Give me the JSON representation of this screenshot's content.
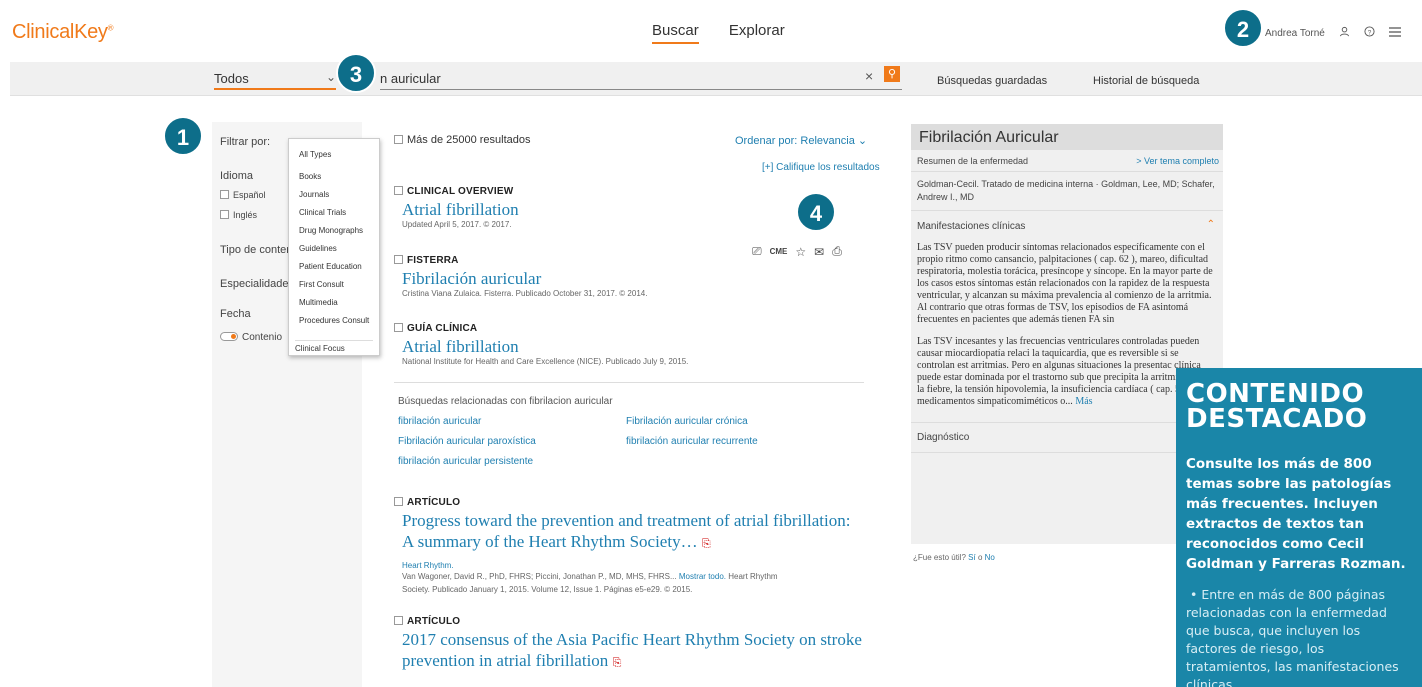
{
  "header": {
    "logo": "ClinicalKey",
    "logo_mark": "®",
    "nav": [
      "Buscar",
      "Explorar"
    ],
    "user_name": "Andrea Torné"
  },
  "search": {
    "scope": "Todos",
    "query": "n auricular",
    "saved": "Búsquedas guardadas",
    "history": "Historial de búsqueda"
  },
  "badges": [
    "1",
    "2",
    "3",
    "4"
  ],
  "filters": {
    "title": "Filtrar por:",
    "language_label": "Idioma",
    "languages": [
      "Español",
      "Inglés"
    ],
    "content_type": "Tipo de conter",
    "specialty": "Especialidade",
    "date": "Fecha",
    "content_toggle": "Contenio"
  },
  "dropdown": [
    "All Types",
    "Books",
    "Journals",
    "Clinical Trials",
    "Drug Monographs",
    "Guidelines",
    "Patient Education",
    "First Consult",
    "Multimedia",
    "Procedures Consult",
    "Clinical Focus"
  ],
  "results": {
    "count": "Más de 25000 resultados",
    "sort": "Ordenar por: Relevancia",
    "rate": "[+] Califique los resultados",
    "items": [
      {
        "label": "CLINICAL OVERVIEW",
        "title": "Atrial fibrillation",
        "meta": "Updated April 5, 2017. © 2017."
      },
      {
        "label": "FISTERRA",
        "title": "Fibrilación auricular",
        "meta": "Cristina Viana Zulaica. Fisterra. Publicado October 31, 2017. © 2014."
      },
      {
        "label": "GUÍA CLÍNICA",
        "title": "Atrial fibrillation",
        "meta": "National Institute for Health and Care Excellence (NICE). Publicado July 9, 2015."
      }
    ],
    "related_title": "Búsquedas relacionadas con fibrilacion auricular",
    "related": [
      "fibrilación auricular",
      "Fibrilación auricular crónica",
      "Fibrilación auricular paroxística",
      "fibrilación auricular recurrente",
      "fibrilación auricular persistente"
    ],
    "article1": {
      "label": "ARTÍCULO",
      "title": "Progress toward the prevention and treatment of atrial fibrillation: A summary of the Heart Rhythm Society…",
      "journal": "Heart Rhythm.",
      "authors": "Van Wagoner, David R., PhD, FHRS; Piccini, Jonathan P., MD, MHS, FHRS...",
      "more": "Mostrar todo.",
      "source": "Heart Rhythm",
      "pub": "Society. Publicado January 1, 2015. Volume 12, Issue 1. Páginas e5-e29. © 2015."
    },
    "article2": {
      "label": "ARTÍCULO",
      "title": "2017 consensus of the Asia Pacific Heart Rhythm Society on stroke prevention in atrial fibrillation"
    },
    "tools": {
      "cme": "CME"
    }
  },
  "topic": {
    "title": "Fibrilación Auricular",
    "summary": "Resumen de la enfermedad",
    "full": "> Ver tema completo",
    "source": "Goldman-Cecil. Tratado de medicina interna · Goldman, Lee, MD; Schafer, Andrew I., MD",
    "section": "Manifestaciones clínicas",
    "p1": "Las TSV pueden producir síntomas relacionados específicamente con el propio ritmo como cansancio, palpitaciones ( cap. 62 ), mareo, dificultad respiratoria, molestia torácica, presíncope y síncope. En la mayor parte de los casos estos síntomas están relacionados con la rapidez de la respuesta ventricular, y alcanzan su máxima prevalencia al comienzo de la arritmia. Al contrario que otras formas de TSV, los episodios de FA asintomá frecuentes en pacientes que además tienen FA sin",
    "p2": "Las TSV incesantes y las frecuencias ventriculares controladas pueden causar miocardiopatía relaci la taquicardia, que es reversible si se controlan est arritmias. Pero en algunas situaciones la presentac clínica puede estar dominada por el trastorno sub que precipita la arritmia, como la fiebre, la tensión hipovolemia, la insuficiencia cardíaca ( cap. 58 ), l los medicamentos simpaticomiméticos o...",
    "more": "Más",
    "diag": "Diagnóstico",
    "useful": "¿Fue esto útil?",
    "yes": "Sí",
    "o": "o",
    "no": "No"
  },
  "featured": {
    "title": "CONTENIDO DESTACADO",
    "text": "Consulte los más de 800 temas sobre las patologías más frecuentes. Incluyen extractos de textos tan reconocidos como Cecil Goldman y Farreras Rozman.",
    "bullet": "Entre en más de 800 páginas relacionadas con la enfermedad que busca, que incluyen los factores de riesgo, los tratamientos, las manifestaciones clínicas"
  }
}
